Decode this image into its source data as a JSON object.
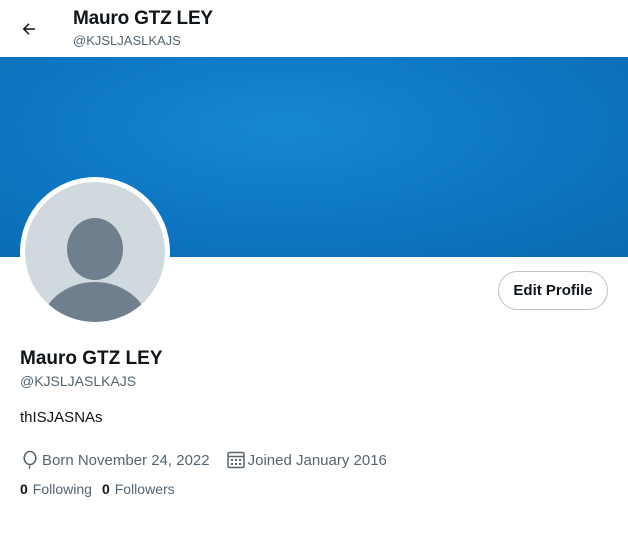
{
  "header": {
    "name": "Mauro GTZ LEY",
    "handle": "@KJSLJASLKAJS"
  },
  "banner": {
    "color": "#0d76c2"
  },
  "profile": {
    "name": "Mauro GTZ LEY",
    "handle": "@KJSLJASLKAJS",
    "bio": "thISJASNAs",
    "edit_label": "Edit Profile",
    "born": "Born November 24, 2022",
    "joined": "Joined January 2016",
    "following_count": "0",
    "following_label": "Following",
    "followers_count": "0",
    "followers_label": "Followers"
  },
  "icons": {
    "back": "arrow-left-icon",
    "born": "balloon-icon",
    "joined": "calendar-icon"
  }
}
